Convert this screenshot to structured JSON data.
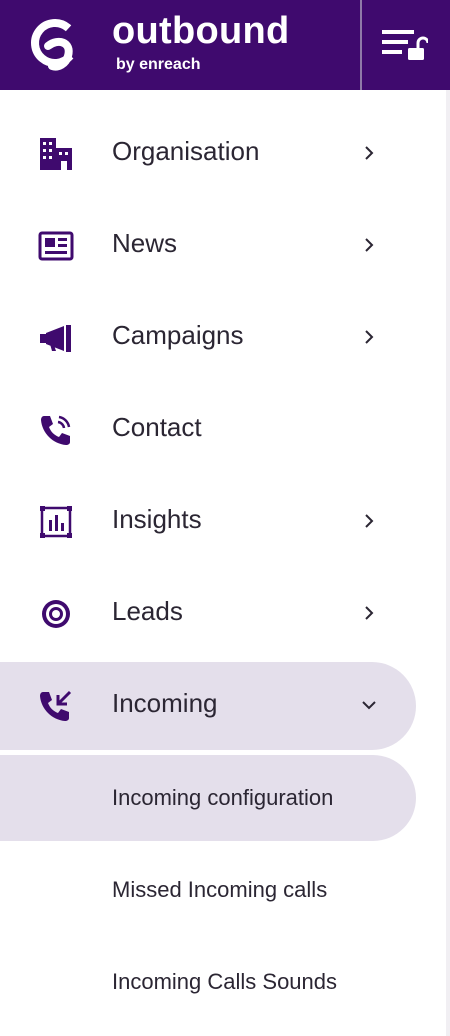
{
  "brand": {
    "name": "outbound",
    "sub": "by enreach"
  },
  "colors": {
    "header": "#3f0a6e",
    "icon": "#3f0a6e",
    "active_bg": "#e4dfeb",
    "text": "#2b2633"
  },
  "menu": [
    {
      "label": "Organisation",
      "icon": "building-icon",
      "has_chevron": "right"
    },
    {
      "label": "News",
      "icon": "newspaper-icon",
      "has_chevron": "right"
    },
    {
      "label": "Campaigns",
      "icon": "megaphone-icon",
      "has_chevron": "right"
    },
    {
      "label": "Contact",
      "icon": "phone-ringing-icon",
      "has_chevron": "none"
    },
    {
      "label": "Insights",
      "icon": "chart-icon",
      "has_chevron": "right"
    },
    {
      "label": "Leads",
      "icon": "target-icon",
      "has_chevron": "right"
    },
    {
      "label": "Incoming",
      "icon": "incoming-call-icon",
      "has_chevron": "down",
      "expanded": true,
      "active": true
    }
  ],
  "submenu": [
    {
      "label": "Incoming configuration",
      "active": true
    },
    {
      "label": "Missed Incoming calls"
    },
    {
      "label": "Incoming Calls Sounds"
    }
  ]
}
